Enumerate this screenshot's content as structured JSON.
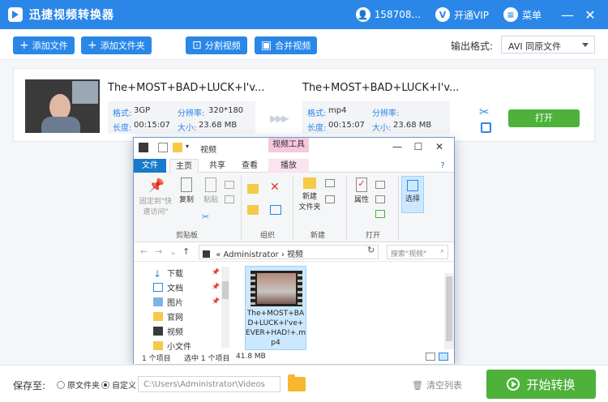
{
  "app": {
    "title": "迅捷视频转换器",
    "account": "158708...",
    "vip_label": "开通VIP",
    "menu_label": "菜单",
    "minimize": "—",
    "close": "✕"
  },
  "toolbar": {
    "add_file": "添加文件",
    "add_folder": "添加文件夹",
    "split_video": "分割视频",
    "merge_video": "合并视频",
    "output_format_label": "输出格式:",
    "output_format_value": "AVI  同原文件"
  },
  "file_row": {
    "source": {
      "name": "The+MOST+BAD+LUCK+I'v...",
      "format_label": "格式:",
      "format": "3GP",
      "resolution_label": "分辨率:",
      "resolution": "320*180",
      "duration_label": "长度:",
      "duration": "00:15:07",
      "size_label": "大小:",
      "size": "23.68 MB"
    },
    "target": {
      "name": "The+MOST+BAD+LUCK+I'v...",
      "format_label": "格式:",
      "format": "mp4",
      "resolution_label": "分辨率:",
      "resolution": "",
      "duration_label": "长度:",
      "duration": "00:15:07",
      "size_label": "大小:",
      "size": "23.68 MB"
    },
    "open_button": "打开"
  },
  "explorer": {
    "title": "视频",
    "tools_tab": "视频工具",
    "tabs": [
      "文件",
      "主页",
      "共享",
      "查看",
      "播放"
    ],
    "ribbon": {
      "pin": "固定到\"快\n速访问\"",
      "copy": "复制",
      "paste": "粘贴",
      "clipboard_group": "剪贴板",
      "organize_group": "组织",
      "new_folder": "新建\n文件夹",
      "new_group": "新建",
      "properties": "属性",
      "open_group": "打开",
      "select": "选择"
    },
    "address": {
      "prefix": "«",
      "segments": [
        "Administrator",
        "视频"
      ],
      "search_placeholder": "搜索\"视频\""
    },
    "nav_items": [
      {
        "label": "下载",
        "icon": "download-icon"
      },
      {
        "label": "文档",
        "icon": "document-icon"
      },
      {
        "label": "图片",
        "icon": "picture-icon"
      },
      {
        "label": "官网",
        "icon": "folder-icon"
      },
      {
        "label": "视频",
        "icon": "video-folder-icon"
      },
      {
        "label": "小文件",
        "icon": "folder-icon"
      }
    ],
    "file": {
      "name": "The+MOST+BAD+LUCK+I've+EVER+HAD!+.mp4"
    },
    "status": {
      "count": "1 个项目",
      "selected": "选中 1 个项目",
      "size": "41.8 MB"
    }
  },
  "bottom": {
    "save_to_label": "保存至:",
    "option_original": "原文件夹",
    "option_custom": "自定义",
    "path": "C:\\Users\\Administrator\\Videos",
    "clear_list": "清空列表",
    "start_button": "开始转换"
  }
}
